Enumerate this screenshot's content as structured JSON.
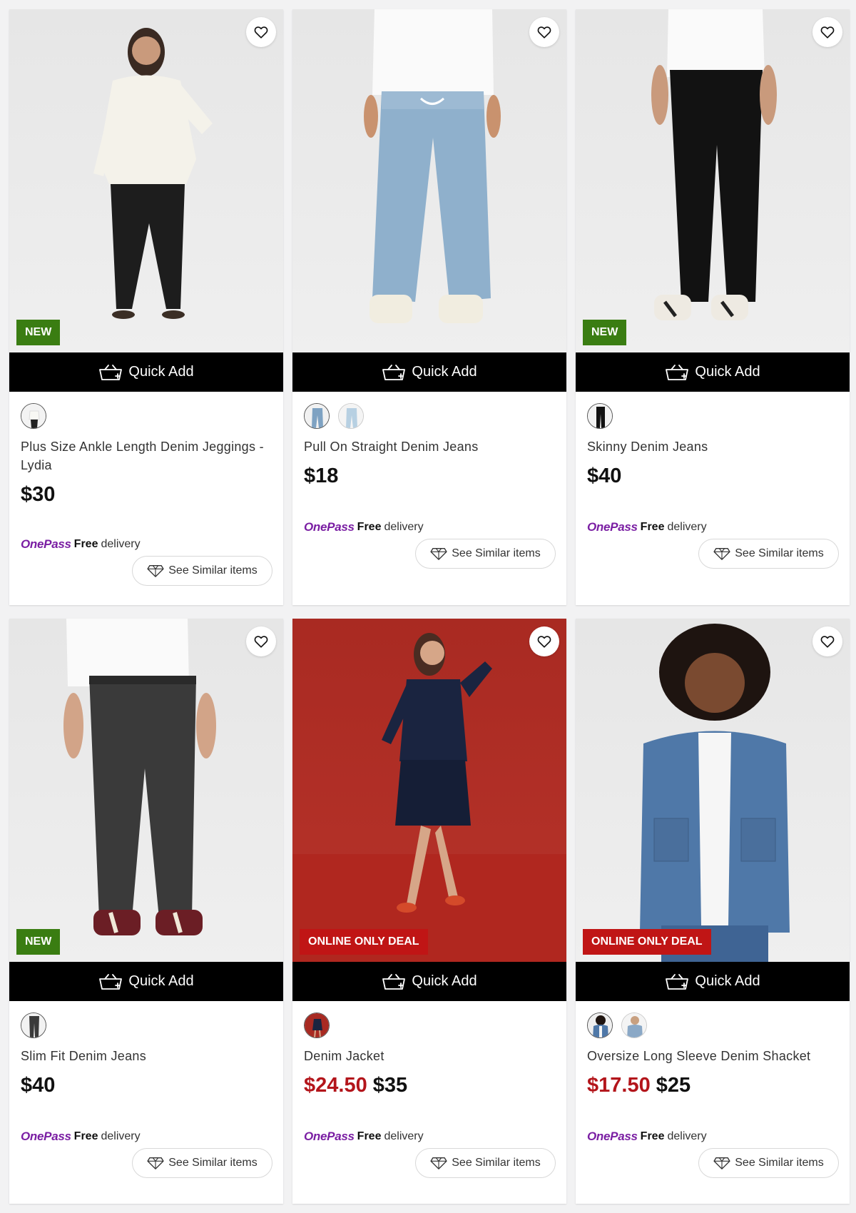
{
  "common": {
    "quick_add": "Quick Add",
    "onepass": "OnePass",
    "free": "Free",
    "delivery": "delivery",
    "see_similar": "See Similar items"
  },
  "colors": {
    "badge_new": "#3a7d12",
    "badge_deal": "#c01515",
    "sale_price": "#b3151b",
    "onepass": "#7a1ea3"
  },
  "products": [
    {
      "name": "Plus Size Ankle Length Denim Jeggings - Lydia",
      "price": "$30",
      "badge": "NEW",
      "swatches": 1
    },
    {
      "name": "Pull On Straight Denim Jeans",
      "price": "$18",
      "badge": "",
      "swatches": 2
    },
    {
      "name": "Skinny Denim Jeans",
      "price": "$40",
      "badge": "NEW",
      "swatches": 1
    },
    {
      "name": "Slim Fit Denim Jeans",
      "price": "$40",
      "badge": "NEW",
      "swatches": 1
    },
    {
      "name": "Denim Jacket",
      "sale_price": "$24.50",
      "price": "$35",
      "badge": "ONLINE ONLY DEAL",
      "swatches": 1
    },
    {
      "name": "Oversize Long Sleeve Denim Shacket",
      "sale_price": "$17.50",
      "price": "$25",
      "badge": "ONLINE ONLY DEAL",
      "swatches": 2
    }
  ]
}
